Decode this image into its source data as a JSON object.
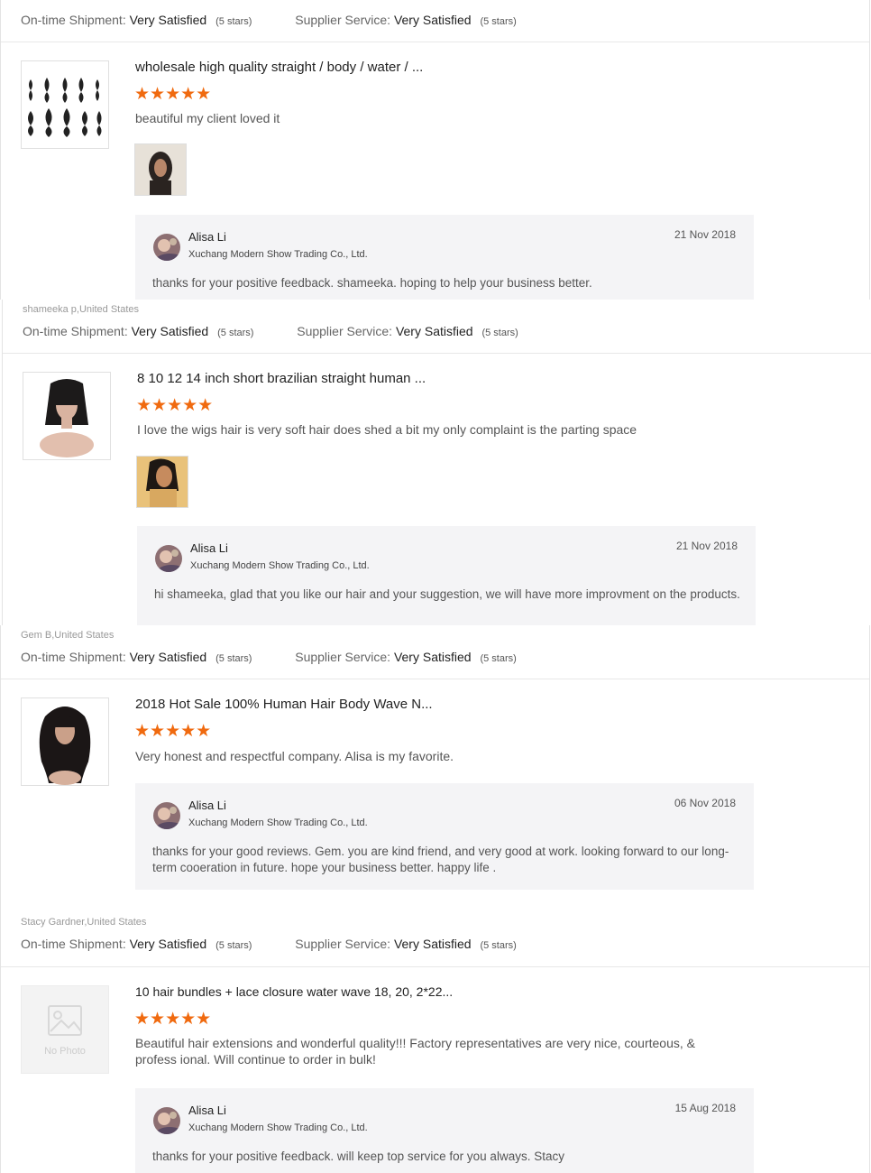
{
  "labels": {
    "shipment": "On-time Shipment:",
    "service": "Supplier Service:",
    "stars_glyph": "★★★★★",
    "no_photo": "No Photo"
  },
  "reviews": [
    {
      "reviewer": "shameeka p,United States",
      "shipment_value": "Very Satisfied",
      "shipment_stars": "(5 stars)",
      "service_value": "Very Satisfied",
      "service_stars": "(5 stars)",
      "title": "wholesale high quality straight / body / water / ...",
      "rating": 5,
      "feedback": "beautiful my client loved it",
      "reply": {
        "name": "Alisa Li",
        "company": "Xuchang Modern Show Trading Co., Ltd.",
        "date": "21 Nov 2018",
        "text": "thanks for your positive feedback. shameeka.  hoping to help your business better."
      }
    },
    {
      "reviewer": "shameeka p,United States",
      "shipment_value": "Very Satisfied",
      "shipment_stars": "(5 stars)",
      "service_value": "Very Satisfied",
      "service_stars": "(5 stars)",
      "title": "8 10 12 14 inch short brazilian straight human ...",
      "rating": 5,
      "feedback": "I love the wigs hair is very soft hair does shed a bit my only complaint is the parting space",
      "reply": {
        "name": "Alisa Li",
        "company": "Xuchang Modern Show Trading Co., Ltd.",
        "date": "21 Nov 2018",
        "text": "hi shameeka, glad that you like our hair and your suggestion,  we will have more improvment on the products."
      }
    },
    {
      "reviewer": "Gem B,United States",
      "shipment_value": "Very Satisfied",
      "shipment_stars": "(5 stars)",
      "service_value": "Very Satisfied",
      "service_stars": "(5 stars)",
      "title": "2018 Hot Sale 100% Human Hair Body Wave N...",
      "rating": 5,
      "feedback": "Very honest and respectful company. Alisa is my favorite.",
      "reply": {
        "name": "Alisa Li",
        "company": "Xuchang Modern Show Trading Co., Ltd.",
        "date": "06 Nov 2018",
        "text": "thanks for your good reviews. Gem. you are kind friend, and very good at work.  looking forward to our long-term cooeration in future. hope your business better.  happy life ."
      }
    },
    {
      "reviewer": "Stacy Gardner,United States",
      "shipment_value": "Very Satisfied",
      "shipment_stars": "(5 stars)",
      "service_value": "Very Satisfied",
      "service_stars": "(5 stars)",
      "title": "10 hair bundles + lace closure water wave 18, 20, 2*22...",
      "rating": 5,
      "feedback": "Beautiful hair extensions and wonderful quality!!! Factory representatives are very nice, courteous, & profess ional. Will continue to order in bulk!",
      "reply": {
        "name": "Alisa Li",
        "company": "Xuchang Modern Show Trading Co., Ltd.",
        "date": "15 Aug 2018",
        "text": "thanks for your positive feedback. will keep top service for you always. Stacy"
      }
    }
  ]
}
